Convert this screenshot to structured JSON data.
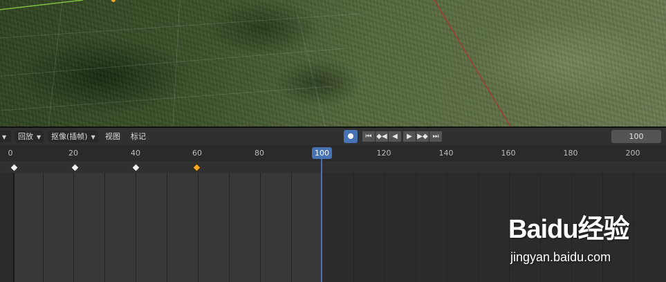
{
  "header": {
    "playback_label": "回放",
    "keying_label": "抠像(插帧)",
    "view_label": "视图",
    "marker_label": "标记",
    "current_frame_value": "100"
  },
  "transport": {
    "jump_start_icon": "jump-to-start-icon",
    "prev_keyframe_icon": "previous-keyframe-icon",
    "play_reverse_icon": "play-reverse-icon",
    "play_icon": "play-icon",
    "next_keyframe_icon": "next-keyframe-icon",
    "jump_end_icon": "jump-to-end-icon",
    "record_icon": "record-icon"
  },
  "ruler": {
    "ticks": [
      "0",
      "20",
      "40",
      "60",
      "80",
      "100",
      "120",
      "140",
      "160",
      "180",
      "200"
    ],
    "current_frame": "100"
  },
  "keyframes": [
    {
      "frame": 0,
      "selected": false
    },
    {
      "frame": 20,
      "selected": false
    },
    {
      "frame": 40,
      "selected": false
    },
    {
      "frame": 60,
      "selected": true
    }
  ],
  "colors": {
    "accent": "#4772b3",
    "keyframe_selected": "#f5a623",
    "keyframe": "#f2f2f2"
  },
  "watermark": {
    "logo_text": "Baidu经验",
    "url": "jingyan.baidu.com"
  }
}
